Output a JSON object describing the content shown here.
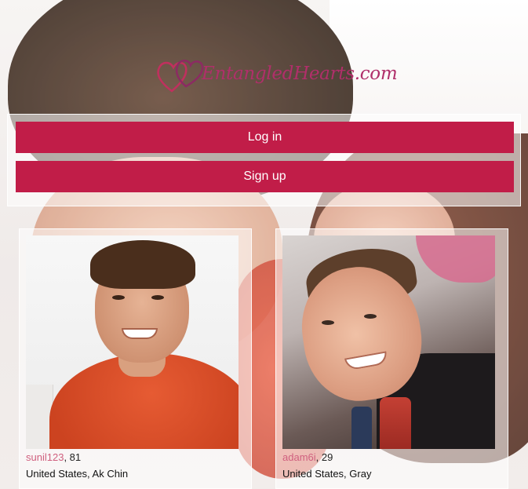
{
  "brand": {
    "name": "EntangledHearts.com",
    "logo_icon": "entangled-hearts-icon",
    "color": "#b02f6a"
  },
  "auth": {
    "login_label": "Log in",
    "signup_label": "Sign up",
    "button_color": "#c11d48"
  },
  "profiles": [
    {
      "username": "sunil123",
      "age_text": ", 81",
      "location": "United States, Ak Chin"
    },
    {
      "username": "adam6i",
      "age_text": ", 29",
      "location": "United States, Gray"
    }
  ]
}
